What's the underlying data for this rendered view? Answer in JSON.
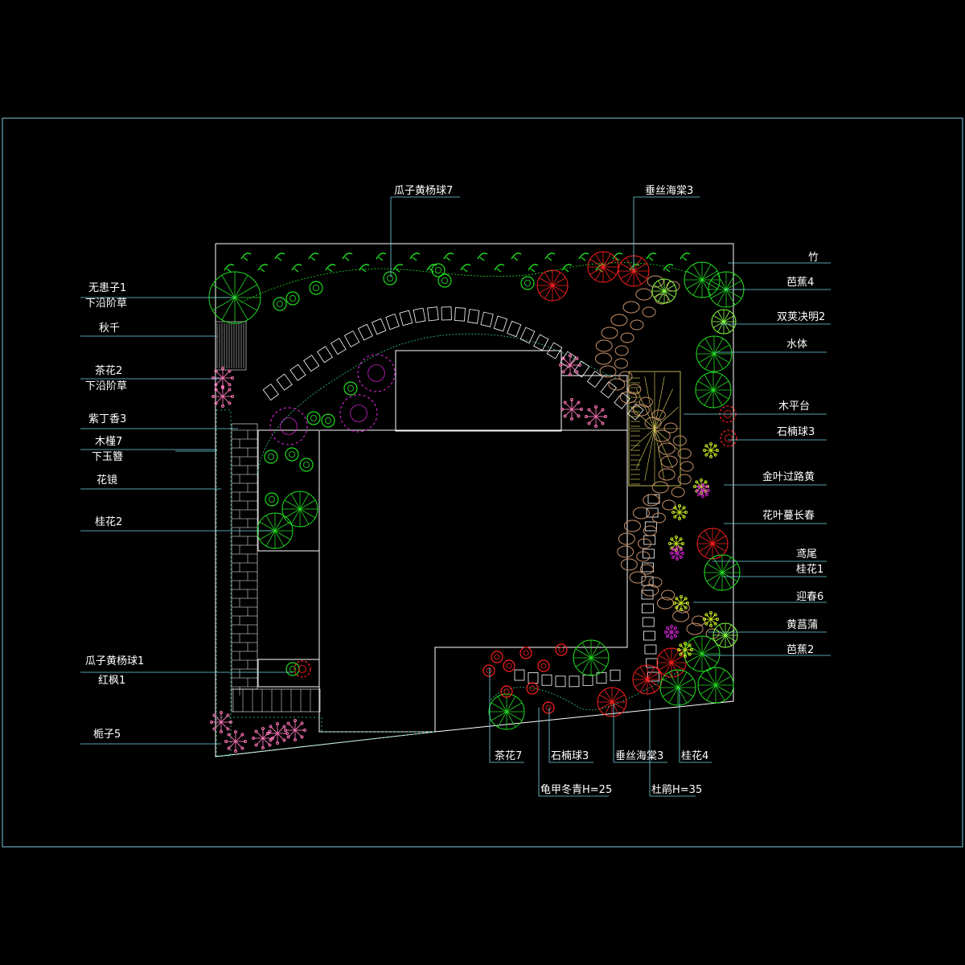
{
  "colors": {
    "background": "#000000",
    "frame": "#7ec8e3",
    "outline": "#ffffff",
    "leader": "#6fd6e8",
    "tree_green": "#22dd22",
    "tree_red": "#ff2020",
    "flower_pink": "#ff77bb",
    "flower_magenta": "#cc22cc",
    "rockery": "#c8926a",
    "deck": "#e8e060",
    "hedge": "#33cc88"
  },
  "labels": {
    "left": [
      "无患子1",
      "下沿阶草",
      "秋千",
      "茶花2",
      "下沿阶草",
      "紫丁香3",
      "木槿7",
      "下玉簪",
      "花镜",
      "桂花2",
      "瓜子黄杨球1",
      "红枫1",
      "栀子5"
    ],
    "top": [
      "瓜子黄杨球7",
      "垂丝海棠3"
    ],
    "right": [
      "竹",
      "芭蕉4",
      "双荚决明2",
      "水体",
      "木平台",
      "石楠球3",
      "金叶过路黄",
      "花叶蔓长春",
      "鸢尾",
      "桂花1",
      "迎春6",
      "黄菖蒲",
      "芭蕉2"
    ],
    "bottom": [
      "茶花7",
      "石楠球3",
      "垂丝海棠3",
      "桂花4",
      "龟甲冬青H=25",
      "杜鹃H=35"
    ]
  }
}
